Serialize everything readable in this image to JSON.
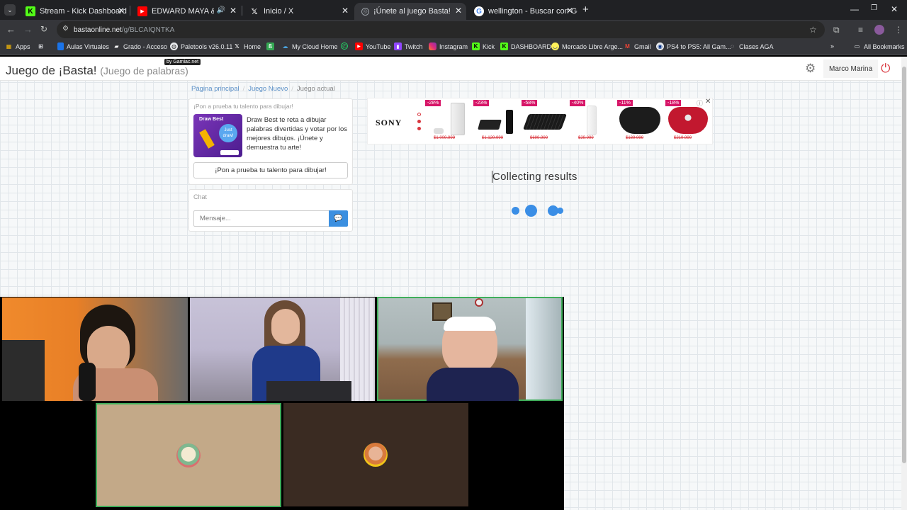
{
  "tabs": [
    {
      "title": "Stream - Kick Dashboard",
      "icon": "kick-icon",
      "active": false
    },
    {
      "title": "EDWARD MAYA & VIKA JIGULINA",
      "icon": "youtube-icon",
      "active": false
    },
    {
      "title": "Inicio / X",
      "icon": "x-icon",
      "active": false
    },
    {
      "title": "¡Únete al juego Basta!",
      "icon": "globe-icon",
      "active": true
    },
    {
      "title": "wellington - Buscar con Google",
      "icon": "google-icon",
      "active": false
    }
  ],
  "address": {
    "domain": "bastaonline.net",
    "path": "/g/BLCAIQNTKA"
  },
  "bookmarks": [
    {
      "label": "Apps"
    },
    {
      "label": ""
    },
    {
      "label": "Aulas Virtuales"
    },
    {
      "label": "Grado - Acceso"
    },
    {
      "label": "Paletools v26.0.11"
    },
    {
      "label": "Home"
    },
    {
      "label": ""
    },
    {
      "label": "My Cloud Home"
    },
    {
      "label": ""
    },
    {
      "label": "YouTube"
    },
    {
      "label": "Twitch"
    },
    {
      "label": "Instagram"
    },
    {
      "label": "Kick"
    },
    {
      "label": "DASHBOARD"
    },
    {
      "label": "Mercado Libre Arge..."
    },
    {
      "label": "Gmail"
    },
    {
      "label": "PS4 to PS5: All Gam..."
    },
    {
      "label": "Clases AGA"
    }
  ],
  "all_bookmarks": "All Bookmarks",
  "header": {
    "title": "Juego de ¡Basta!",
    "subtitle": "(Juego de palabras)",
    "badge": "by Gamiac.net",
    "user": "Marco Marina"
  },
  "breadcrumb": [
    "Página principal",
    "Juego Nuevo",
    "Juego actual"
  ],
  "promo": {
    "heading": "¡Pon a prueba tu talento para dibujar!",
    "image_title": "Draw Best",
    "image_badge": "Just draw!",
    "text": "Draw Best te reta a dibujar palabras divertidas y votar por los mejores dibujos. ¡Únete y demuestra tu arte!",
    "button": "¡Pon a prueba tu talento para dibujar!"
  },
  "chat": {
    "label": "Chat",
    "placeholder": "Mensaje..."
  },
  "ad": {
    "brand": "SONY",
    "items": [
      {
        "discount": "-28%",
        "price": "$1.009.999"
      },
      {
        "discount": "-23%",
        "price": "$1.129.999"
      },
      {
        "discount": "-58%",
        "price": "$699.999"
      },
      {
        "discount": "-40%",
        "price": "$29.999"
      },
      {
        "discount": "-11%",
        "price": "$189.999"
      },
      {
        "discount": "-18%",
        "price": "$219.999"
      }
    ]
  },
  "status": "Collecting results",
  "colors": {
    "accent": "#3b8fe0",
    "power": "#d9363e",
    "highlight": "#3fae5a"
  }
}
